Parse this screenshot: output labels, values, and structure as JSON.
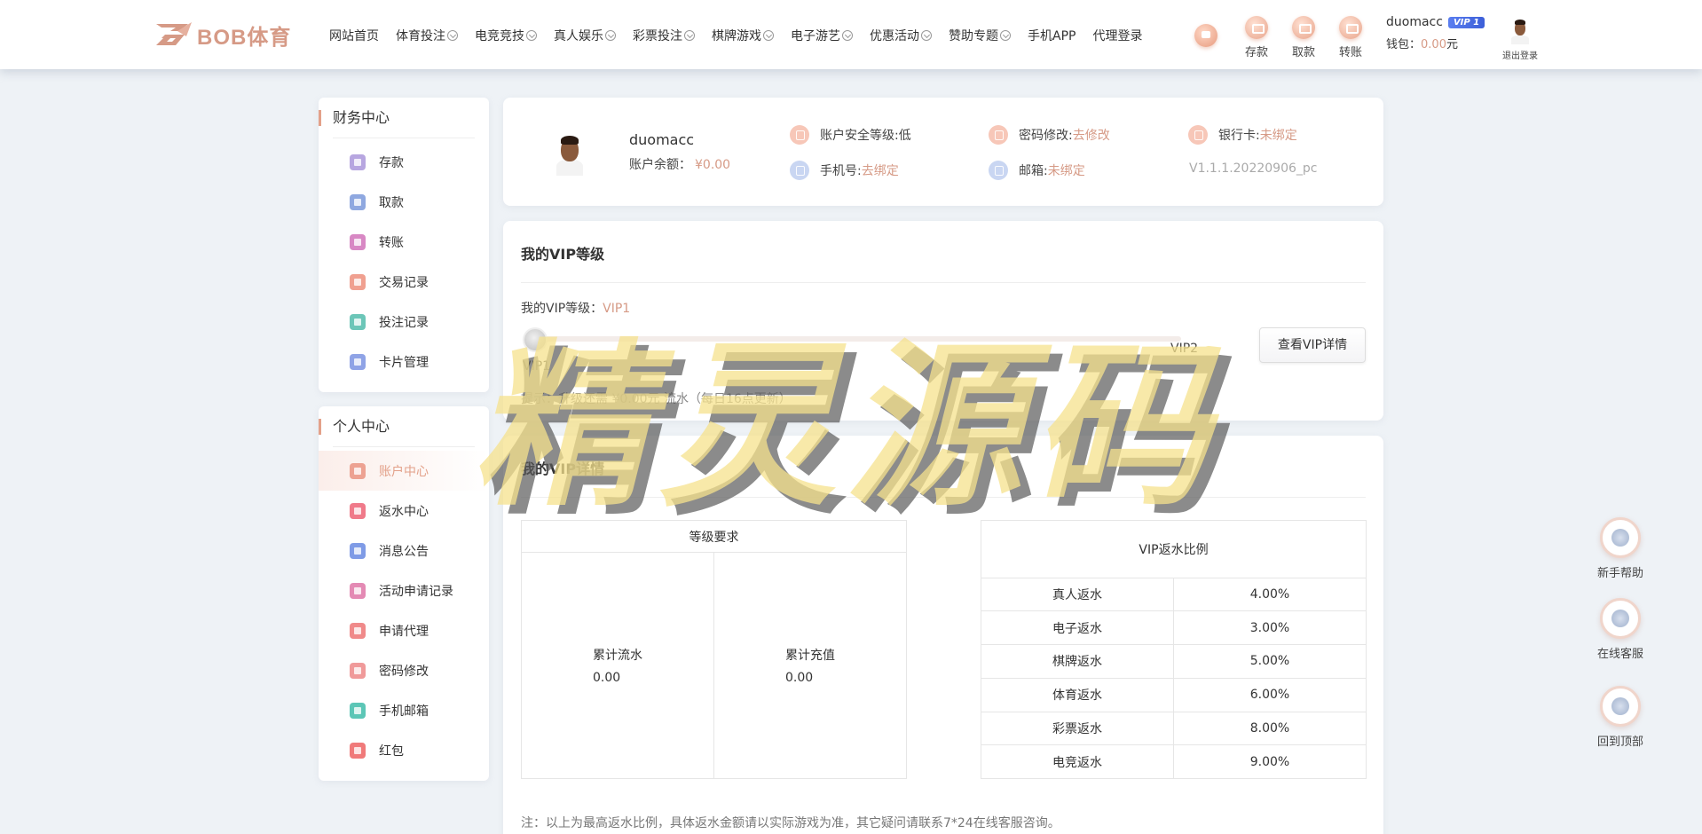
{
  "header": {
    "logo_text": "BOB体育",
    "nav": [
      {
        "label": "网站首页",
        "dropdown": false
      },
      {
        "label": "体育投注",
        "dropdown": true
      },
      {
        "label": "电竞竞技",
        "dropdown": true
      },
      {
        "label": "真人娱乐",
        "dropdown": true
      },
      {
        "label": "彩票投注",
        "dropdown": true
      },
      {
        "label": "棋牌游戏",
        "dropdown": true
      },
      {
        "label": "电子游艺",
        "dropdown": true
      },
      {
        "label": "优惠活动",
        "dropdown": true
      },
      {
        "label": "赞助专题",
        "dropdown": true
      },
      {
        "label": "手机APP",
        "dropdown": false
      },
      {
        "label": "代理登录",
        "dropdown": false
      }
    ],
    "quick": [
      {
        "label": "存款",
        "icon": "deposit-icon"
      },
      {
        "label": "取款",
        "icon": "withdraw-icon"
      },
      {
        "label": "转账",
        "icon": "transfer-icon"
      }
    ],
    "username": "duomacc",
    "vip_badge": "VIP 1",
    "wallet_label": "钱包：",
    "wallet_amount": "0.00",
    "wallet_unit": "元",
    "logout_label": "退出登录"
  },
  "sidebar": {
    "finance": {
      "title": "财务中心",
      "items": [
        {
          "label": "存款",
          "icon": "deposit-icon",
          "color": "#b7a6e0"
        },
        {
          "label": "取款",
          "icon": "folder-icon",
          "color": "#8fa8e0"
        },
        {
          "label": "转账",
          "icon": "transfer-icon",
          "color": "#d888c4"
        },
        {
          "label": "交易记录",
          "icon": "record-icon",
          "color": "#f0a090"
        },
        {
          "label": "投注记录",
          "icon": "bet-record-icon",
          "color": "#6cc6b8"
        },
        {
          "label": "卡片管理",
          "icon": "card-icon",
          "color": "#8fa3e6"
        }
      ]
    },
    "personal": {
      "title": "个人中心",
      "items": [
        {
          "label": "账户中心",
          "icon": "diamond-icon",
          "color": "#eda292",
          "active": true
        },
        {
          "label": "返水中心",
          "icon": "gift-icon",
          "color": "#f07a8a"
        },
        {
          "label": "消息公告",
          "icon": "bell-icon",
          "color": "#7f9be6"
        },
        {
          "label": "活动申请记录",
          "icon": "user-card-icon",
          "color": "#e48ab4"
        },
        {
          "label": "申请代理",
          "icon": "agent-icon",
          "color": "#f08a8a"
        },
        {
          "label": "密码修改",
          "icon": "lock-icon",
          "color": "#f09a9a"
        },
        {
          "label": "手机邮箱",
          "icon": "mail-icon",
          "color": "#5cc6b6"
        },
        {
          "label": "红包",
          "icon": "red-packet-icon",
          "color": "#f07a7a"
        }
      ]
    }
  },
  "profile": {
    "name": "duomacc",
    "balance_label": "账户余额：",
    "balance": "¥0.00",
    "security_label": "账户安全等级: ",
    "security_value": "低",
    "password_label": "密码修改: ",
    "password_link": "去修改",
    "bank_label": "银行卡: ",
    "bank_link": "未绑定",
    "phone_label": "手机号: ",
    "phone_link": "去绑定",
    "email_label": "邮箱: ",
    "email_link": "未绑定",
    "version": "V1.1.1.20220906_pc"
  },
  "vip": {
    "title": "我的VIP等级",
    "level_label": "我的VIP等级：",
    "level": "VIP1",
    "from": "VIP1",
    "to": "VIP2",
    "progress": 0.0,
    "details_button": "查看VIP详情",
    "tip": "提示：升级还需 ¥0.00元 流水（每日16点更新）"
  },
  "vip_detail": {
    "title": "我的VIP详情",
    "req_header": "等级要求",
    "req_cols": [
      {
        "label": "累计流水",
        "value": "0.00"
      },
      {
        "label": "累计充值",
        "value": "0.00"
      }
    ],
    "rebate_header": "VIP返水比例",
    "rebates": [
      {
        "name": "真人返水",
        "rate": "4.00%"
      },
      {
        "name": "电子返水",
        "rate": "3.00%"
      },
      {
        "name": "棋牌返水",
        "rate": "5.00%"
      },
      {
        "name": "体育返水",
        "rate": "6.00%"
      },
      {
        "name": "彩票返水",
        "rate": "8.00%"
      },
      {
        "name": "电竞返水",
        "rate": "9.00%"
      }
    ],
    "note": "注：以上为最高返水比例，具体返水金额请以实际游戏为准，其它疑问请联系7*24在线客服咨询。"
  },
  "floating": [
    {
      "label": "新手帮助",
      "icon": "help-icon"
    },
    {
      "label": "在线客服",
      "icon": "headset-icon"
    },
    {
      "label": "回到顶部",
      "icon": "arrow-up-icon"
    }
  ],
  "watermark": "精灵源码"
}
